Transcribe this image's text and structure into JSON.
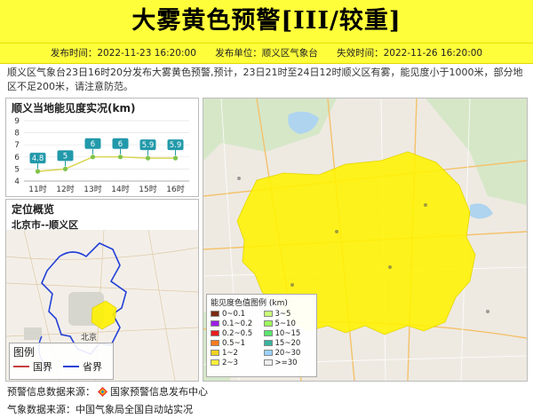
{
  "header": {
    "title": "大雾黄色预警[III/较重]",
    "publish_time": "发布时间：2022-11-23 16:20:00",
    "publisher": "发布单位：顺义区气象台",
    "expire_time": "失效时间：2022-11-26 16:20:00"
  },
  "description": "顺义区气象台23日16时20分发布大雾黄色预警,预计，23日21时至24日12时顺义区有雾，能见度小于1000米，部分地区不足200米，请注意防范。",
  "chart_panel": {
    "title": "顺义当地能见度实况(km)"
  },
  "chart_data": {
    "type": "line",
    "categories": [
      "11时",
      "12时",
      "13时",
      "14时",
      "15时",
      "16时"
    ],
    "values": [
      4.8,
      5,
      6,
      6,
      5.9,
      5.9
    ],
    "value_labels": [
      "4.8",
      "5",
      "6",
      "6",
      "5.9",
      "5.9"
    ],
    "y_ticks": [
      "4",
      "5",
      "6",
      "7",
      "8",
      "9"
    ],
    "ylim": [
      4,
      9
    ],
    "title": "顺义当地能见度实况(km)",
    "grid": true,
    "line_color": "#d8d24a",
    "label_color": "#2299aa"
  },
  "location_panel": {
    "title": "定位概览",
    "subtitle": "北京市--顺义区",
    "city_label": "北京",
    "legend": {
      "title": "图例",
      "national": "国界",
      "provincial": "省界"
    }
  },
  "visibility_legend": {
    "title": "能见度色值图例 (km)",
    "items": [
      {
        "label": "0~0.1",
        "color": "#7a2a12"
      },
      {
        "label": "3~5",
        "color": "#c8ff7a"
      },
      {
        "label": "0.1~0.2",
        "color": "#9a1ee6"
      },
      {
        "label": "5~10",
        "color": "#9eff5a"
      },
      {
        "label": "0.2~0.5",
        "color": "#e61e1e"
      },
      {
        "label": "10~15",
        "color": "#5ae66e"
      },
      {
        "label": "0.5~1",
        "color": "#ff7a1e"
      },
      {
        "label": "15~20",
        "color": "#3ab4a0"
      },
      {
        "label": "1~2",
        "color": "#f0d21e"
      },
      {
        "label": "20~30",
        "color": "#9ad2ff"
      },
      {
        "label": "2~3",
        "color": "#fff03a"
      },
      {
        "label": ">=30",
        "color": "#eeeeee"
      }
    ]
  },
  "footer": {
    "source1": "预警信息数据来源：",
    "source1_org": "国家预警信息发布中心",
    "source2": "气象数据来源：中国气象局全国自动站实况"
  },
  "colors": {
    "banner": "#fffe3b",
    "fog_area": "#fff200"
  }
}
